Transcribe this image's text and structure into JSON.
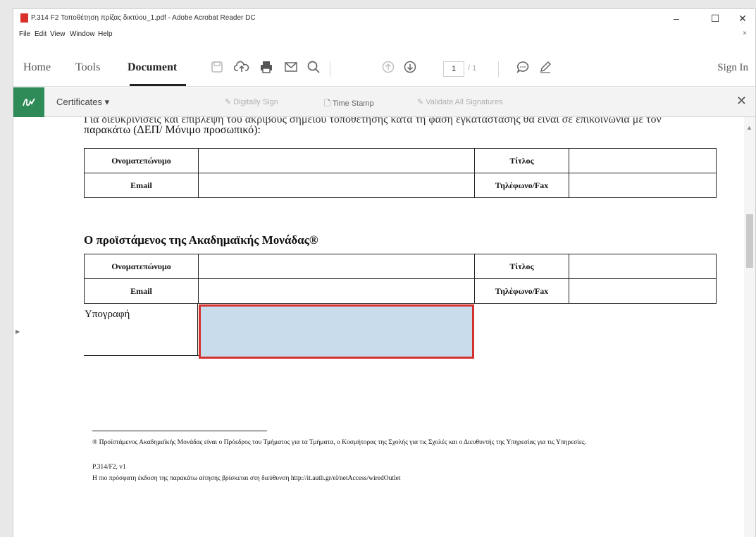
{
  "window": {
    "title": "P.314 F2 Τοποθέτηση πρίζας δικτύου_1.pdf - Adobe Acrobat Reader DC",
    "controls": {
      "minimize": "–",
      "maximize": "☐",
      "close": "✕"
    }
  },
  "menu": {
    "items": [
      "File",
      "Edit",
      "View",
      "Window",
      "Help"
    ],
    "close": "×"
  },
  "toolbar": {
    "tabs": [
      "Home",
      "Tools",
      "Document"
    ],
    "active_tab": "Document",
    "page_current": "1",
    "page_total": "/ 1",
    "sign_in": "Sign In"
  },
  "certbar": {
    "label": "Certificates ▾",
    "digitally_sign": "Digitally Sign",
    "time_stamp": "Time Stamp",
    "validate_all": "Validate All Signatures"
  },
  "document": {
    "cut_line": "Για διευκρινίσεις και επίβλεψη του ακριβούς σημείου τοποθέτησης κατά τη φάση εγκατάστασης θα είναι σε επικοινωνία με τον",
    "intro": "παρακάτω (ΔΕΠ/ Μόνιμο προσωπικό):",
    "table1": {
      "row1": {
        "name_label": "Ονοματεπώνυμο",
        "title_label": "Τίτλος"
      },
      "row2": {
        "email_label": "Email",
        "phone_label": "Τηλέφωνο/Fax"
      }
    },
    "section_title": "Ο προϊστάμενος της Ακαδημαϊκής Μονάδας®",
    "table2": {
      "row1": {
        "name_label": "Ονοματεπώνυμο",
        "title_label": "Τίτλος"
      },
      "row2": {
        "email_label": "Email",
        "phone_label": "Τηλέφωνο/Fax"
      }
    },
    "signature_label": "Υπογραφή",
    "footnote": "® Προϊστάμενος Ακαδημαϊκής Μονάδας είναι ο Πρόεδρος του Τμήματος για τα Τμήματα, ο Κοσμήτορας της Σχολής για τις Σχολές και ο Διευθυντής της Υπηρεσίας για τις Υπηρεσίες.",
    "form_code": "P.314/F2, v1",
    "availability": "Η πιο πρόσφατη έκδοση της παρακάτω αίτησης βρίσκεται στη διεύθυνση http://it.auth.gr/el/netAccess/wiredOutlet"
  }
}
